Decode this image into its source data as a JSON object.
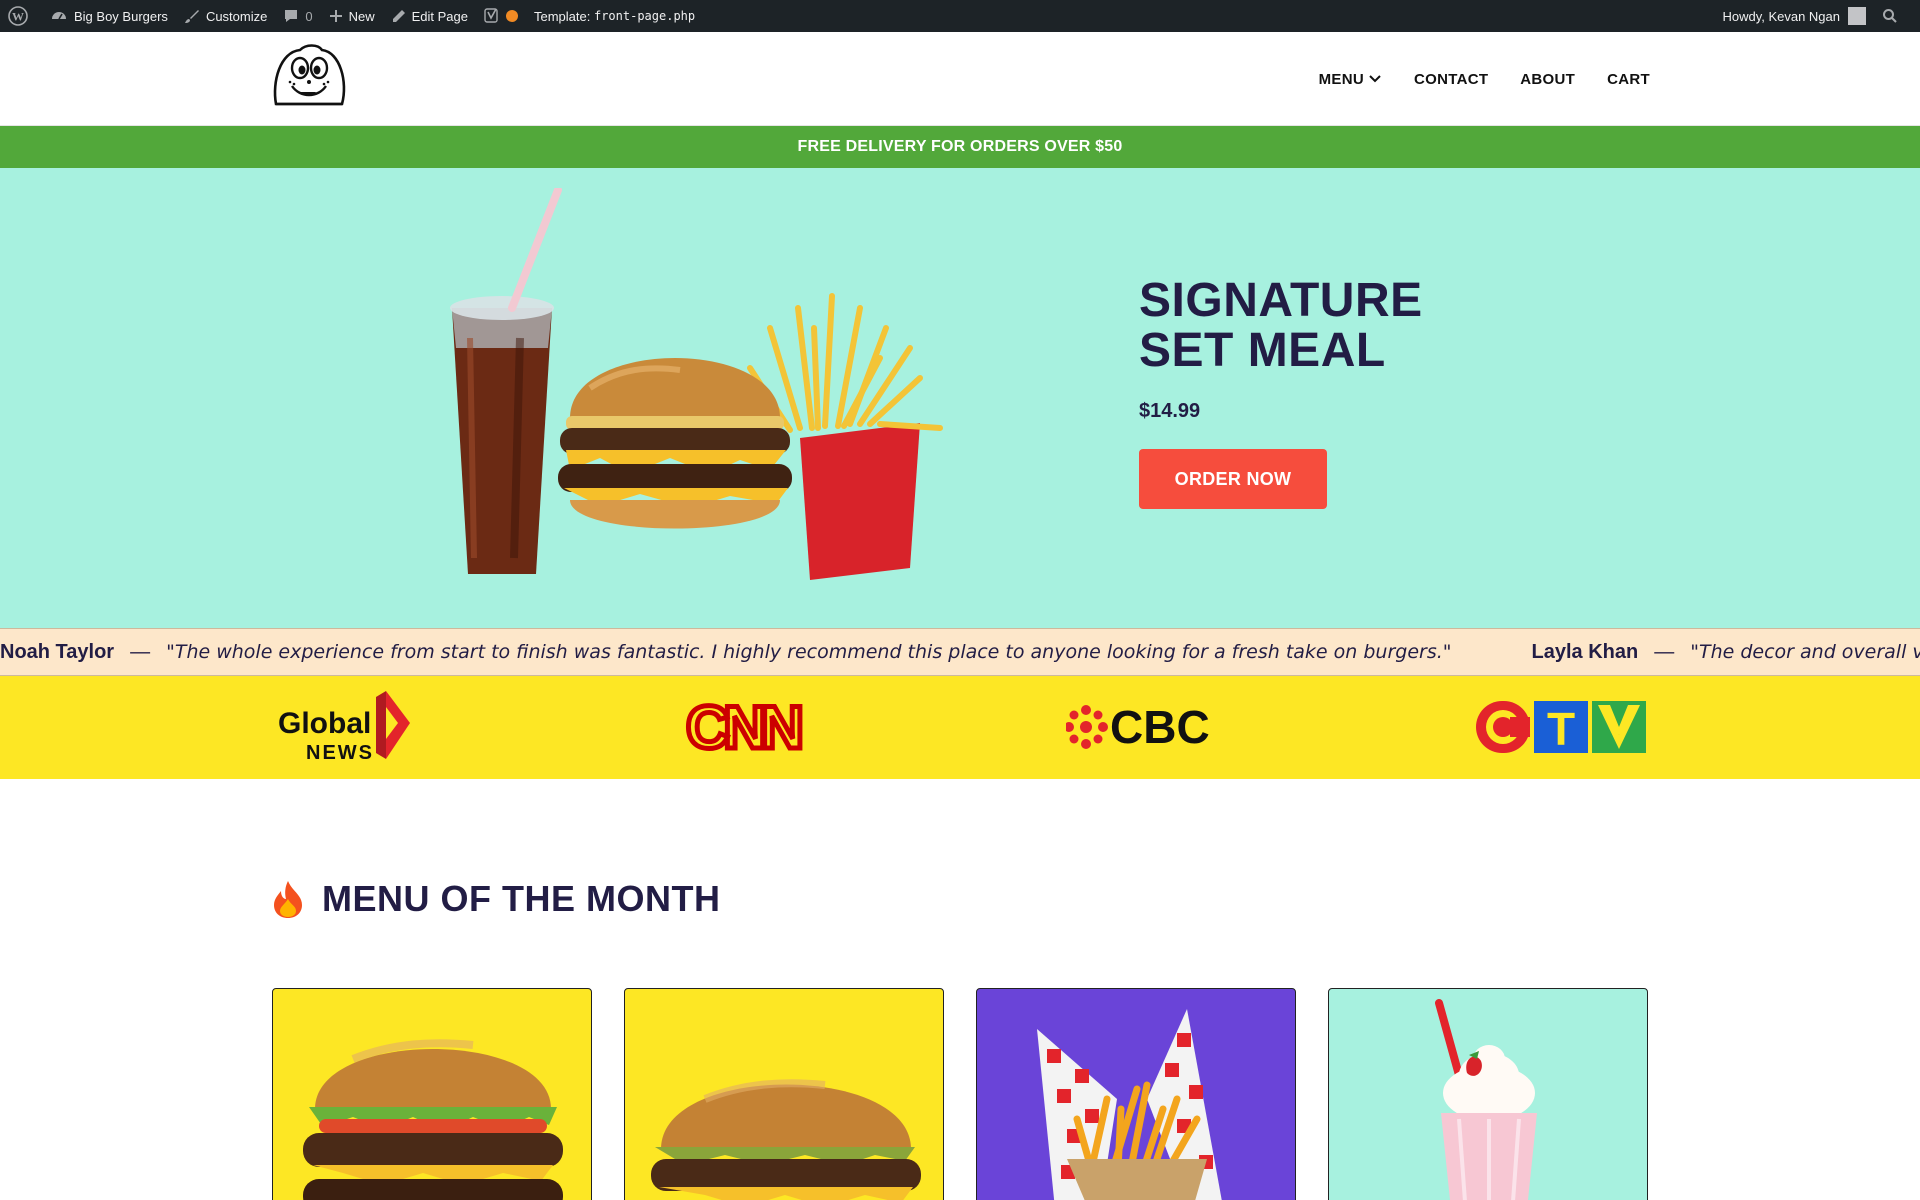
{
  "adminbar": {
    "site_name": "Big Boy Burgers",
    "customize": "Customize",
    "comments_count": "0",
    "new_label": "New",
    "edit_page": "Edit Page",
    "template_label": "Template:",
    "template_file": "front-page.php",
    "howdy": "Howdy, Kevan Ngan"
  },
  "nav": {
    "menu": "MENU",
    "contact": "CONTACT",
    "about": "ABOUT",
    "cart": "CART"
  },
  "promo": {
    "text": "FREE DELIVERY FOR ORDERS OVER $50"
  },
  "hero": {
    "title_line1": "SIGNATURE",
    "title_line2": "SET MEAL",
    "price": "$14.99",
    "cta": "ORDER NOW"
  },
  "testimonials": [
    {
      "name": "Noah Taylor",
      "quote": "\"The whole experience from start to finish was fantastic. I highly recommend this place to anyone looking for a fresh take on burgers.\""
    },
    {
      "name": "Layla Khan",
      "quote": "\"The decor and overall vibe of th"
    }
  ],
  "press": {
    "global_line1": "Global",
    "global_line2": "NEWS",
    "cnn": "CNN",
    "cbc": "CBC",
    "ctv_c": "C",
    "ctv_t": "T",
    "ctv_v": "V"
  },
  "menu_section": {
    "title": "MENU OF THE MONTH"
  },
  "colors": {
    "promo_green": "#52a83a",
    "hero_mint": "#a7f1df",
    "cta_red": "#f64d3d",
    "press_yellow": "#fde724",
    "ticker_cream": "#fde7ca",
    "card_yellow": "#fde724",
    "card_purple": "#6a44d8",
    "card_mint": "#a7f1df",
    "heading_navy": "#221d45"
  }
}
